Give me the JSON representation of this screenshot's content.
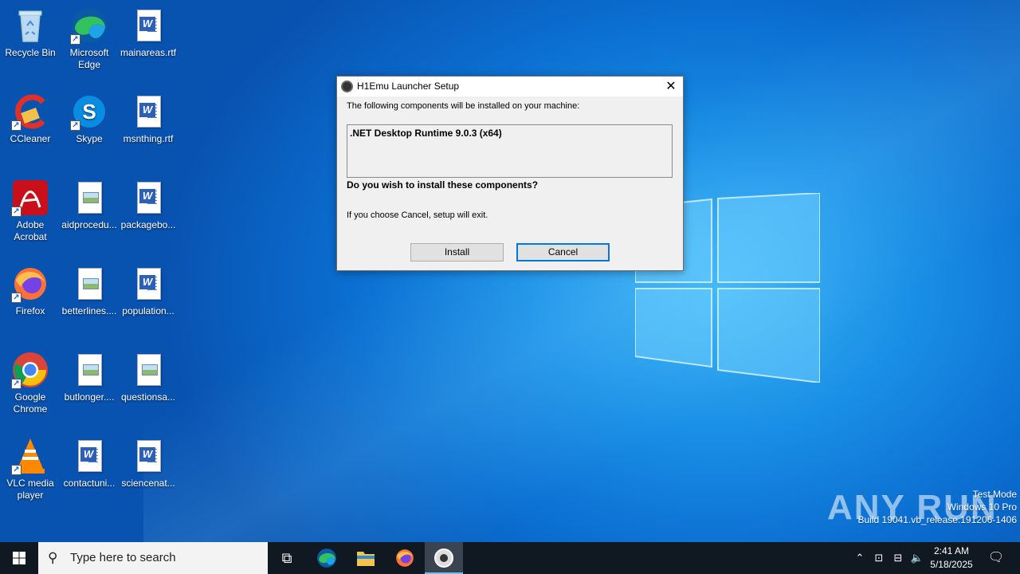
{
  "desktop": {
    "icons": [
      {
        "label": "Recycle Bin"
      },
      {
        "label": "Microsoft Edge"
      },
      {
        "label": "mainareas.rtf"
      },
      {
        "label": "CCleaner"
      },
      {
        "label": "Skype"
      },
      {
        "label": "msnthing.rtf"
      },
      {
        "label": "Adobe Acrobat"
      },
      {
        "label": "aidprocedu..."
      },
      {
        "label": "packagebo..."
      },
      {
        "label": "Firefox"
      },
      {
        "label": "betterlines...."
      },
      {
        "label": "population..."
      },
      {
        "label": "Google Chrome"
      },
      {
        "label": "butlonger...."
      },
      {
        "label": "questionsa..."
      },
      {
        "label": "VLC media player"
      },
      {
        "label": "contactuni..."
      },
      {
        "label": "sciencenat..."
      }
    ]
  },
  "dialog": {
    "title": "H1Emu Launcher Setup",
    "intro": "The following components will be installed on your machine:",
    "components": [
      ".NET Desktop Runtime 9.0.3 (x64)"
    ],
    "question": "Do you wish to install these components?",
    "cancel_info": "If you choose Cancel, setup will exit.",
    "install_label": "Install",
    "cancel_label": "Cancel"
  },
  "watermark": {
    "brand": "ANY RUN",
    "line1": "Test Mode",
    "line2": "Windows 10 Pro",
    "line3": "Build 19041.vb_release.191206-1406"
  },
  "taskbar": {
    "search_placeholder": "Type here to search",
    "time": "2:41 AM",
    "date": "5/18/2025"
  },
  "colors": {
    "accent": "#0078d7",
    "taskbar": "#101922",
    "desktop": "#0b6fd1"
  }
}
